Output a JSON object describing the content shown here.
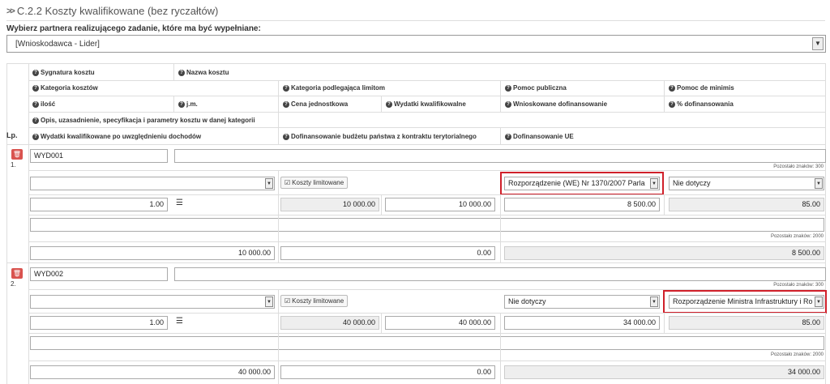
{
  "section": {
    "title": "C.2.2 Koszty kwalifikowane (bez ryczałtów)"
  },
  "partner": {
    "label": "Wybierz partnera realizującego zadanie, które ma być wypełniane:",
    "selected": "[Wnioskodawca - Lider]"
  },
  "headers": {
    "sygnatura": "Sygnatura kosztu",
    "nazwa": "Nazwa kosztu",
    "kategoria": "Kategoria kosztów",
    "limit": "Kategoria podlegająca limitom",
    "pomoc_publiczna": "Pomoc publiczna",
    "de_minimis": "Pomoc de minimis",
    "ilosc": "ilość",
    "jm": "j.m.",
    "cena": "Cena jednostkowa",
    "wydatki": "Wydatki kwalifikowalne",
    "wnioskowane": "Wnioskowane dofinansowanie",
    "procent": "% dofinansowania",
    "opis": "Opis, uzasadnienie, specyfikacja i parametry kosztu w danej kategorii",
    "po_dochodach": "Wydatki kwalifikowane po uwzględnieniu dochodów",
    "budzet": "Dofinansowanie budżetu państwa z kontraktu terytorialnego",
    "ue": "Dofinansowanie UE",
    "lp": "Lp."
  },
  "rows": [
    {
      "num": "1.",
      "signature": "WYD001",
      "name": "",
      "name_counter": "Pozostało znaków: 300",
      "category": "",
      "limit_label": "Koszty limitowane",
      "pomoc_publiczna": "Rozporządzenie (WE) Nr 1370/2007 Parla",
      "de_minimis": "Nie dotyczy",
      "ilosc": "1.00",
      "jm": "",
      "cena": "10 000.00",
      "wydatki": "10 000.00",
      "wnioskowane": "8 500.00",
      "procent": "85.00",
      "opis": "",
      "opis_counter": "Pozostało znaków: 2000",
      "po_dochodach": "10 000.00",
      "budzet": "0.00",
      "ue": "8 500.00"
    },
    {
      "num": "2.",
      "signature": "WYD002",
      "name": "",
      "name_counter": "Pozostało znaków: 300",
      "category": "",
      "limit_label": "Koszty limitowane",
      "pomoc_publiczna": "Nie dotyczy",
      "de_minimis": "Rozporządzenie Ministra Infrastruktury i Ro",
      "ilosc": "1.00",
      "jm": "",
      "cena": "40 000.00",
      "wydatki": "40 000.00",
      "wnioskowane": "34 000.00",
      "procent": "85.00",
      "opis": "",
      "opis_counter": "Pozostało znaków: 2000",
      "po_dochodach": "40 000.00",
      "budzet": "0.00",
      "ue": "34 000.00"
    }
  ],
  "colors": {
    "delete": "#d9534f",
    "highlight": "#d0202a",
    "readonly": "#eeeeee"
  }
}
